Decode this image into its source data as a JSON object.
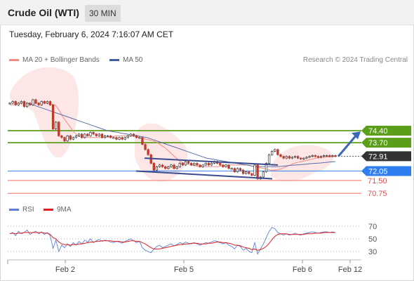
{
  "header": {
    "title": "Crude Oil (WTI)",
    "interval": "30 MIN"
  },
  "timestamp": "Tuesday, February 6, 2024 7:16:07 AM CET",
  "legend": {
    "items": [
      {
        "label": "MA 20 + Bollinger Bands",
        "color": "#f28b82"
      },
      {
        "label": "MA 50",
        "color": "#3f5f9f"
      }
    ],
    "credit": "Research © 2024 Trading Central"
  },
  "rsi_legend": {
    "items": [
      {
        "label": "RSI",
        "color": "#5b7fd6"
      },
      {
        "label": "9MA",
        "color": "#e02020"
      }
    ]
  },
  "colors": {
    "resistance": "#5a9e1a",
    "pivot": "#4f8ef0",
    "support": "#f28b82",
    "current": "#333333",
    "arrow": "#3a66b5",
    "channel": "#3b4a8f"
  },
  "chart_data": [
    {
      "type": "candlestick",
      "ylim": [
        70.2,
        74.9
      ],
      "x_ticks": [
        "Feb 2",
        "Feb 5",
        "Feb 6",
        "Feb 12"
      ],
      "levels": [
        {
          "value": 74.4,
          "label": "74.40",
          "kind": "resistance"
        },
        {
          "value": 73.7,
          "label": "73.70",
          "kind": "resistance"
        },
        {
          "value": 72.91,
          "label": "72.91",
          "kind": "current"
        },
        {
          "value": 72.05,
          "label": "72.05",
          "kind": "pivot"
        },
        {
          "value": 71.5,
          "label": "71.50",
          "kind": "support"
        },
        {
          "value": 70.75,
          "label": "70.75",
          "kind": "support"
        }
      ],
      "close": [
        76.0,
        76.1,
        75.9,
        76.0,
        76.1,
        75.8,
        76.0,
        75.9,
        76.2,
        76.0,
        75.9,
        76.1,
        76.0,
        76.1,
        75.9,
        74.5,
        74.9,
        74.1,
        74.0,
        73.8,
        74.1,
        73.9,
        74.0,
        74.1,
        74.2,
        74.0,
        74.2,
        74.1,
        74.3,
        74.2,
        74.1,
        74.2,
        74.0,
        74.1,
        74.1,
        74.0,
        74.0,
        73.9,
        74.0,
        73.9,
        74.0,
        74.1,
        74.2,
        74.1,
        74.0,
        74.0,
        73.6,
        73.3,
        73.0,
        72.5,
        72.1,
        72.3,
        72.4,
        72.3,
        72.2,
        72.3,
        72.4,
        72.2,
        72.3,
        72.5,
        72.4,
        72.6,
        72.5,
        72.4,
        72.5,
        72.4,
        72.3,
        72.4,
        72.5,
        72.4,
        72.5,
        72.6,
        72.5,
        72.4,
        72.3,
        72.4,
        72.2,
        72.2,
        72.0,
        72.2,
        72.1,
        71.9,
        72.0,
        71.9,
        71.8,
        72.4,
        71.6,
        71.7,
        72.0,
        72.5,
        73.0,
        73.2,
        73.3,
        73.0,
        72.9,
        72.8,
        72.9,
        72.8,
        72.85,
        72.9,
        72.8,
        72.75,
        72.8,
        72.85,
        72.9,
        72.95,
        72.9,
        72.85,
        72.9,
        72.95,
        72.95,
        72.9,
        72.95,
        72.91
      ],
      "ma20": [
        75.9,
        75.9,
        76.0,
        76.0,
        76.0,
        76.0,
        75.9,
        76.0,
        76.0,
        76.0,
        76.0,
        75.9,
        75.9,
        75.6,
        75.2,
        74.9,
        74.6,
        74.3,
        74.1,
        74.0,
        74.0,
        74.0,
        74.0,
        74.0,
        74.0,
        74.0,
        74.0,
        74.05,
        74.1,
        74.1,
        74.1,
        74.1,
        74.1,
        74.05,
        74.0,
        73.95,
        73.9,
        73.85,
        73.8,
        73.7,
        73.55,
        73.4,
        73.2,
        73.0,
        72.8,
        72.6,
        72.5,
        72.45,
        72.4,
        72.35,
        72.3,
        72.3,
        72.3,
        72.3,
        72.3,
        72.3,
        72.35,
        72.35,
        72.4,
        72.4,
        72.4,
        72.4,
        72.4,
        72.4,
        72.35,
        72.3,
        72.25,
        72.2,
        72.15,
        72.1,
        72.1,
        72.15,
        72.2,
        72.3,
        72.4,
        72.5,
        72.55,
        72.6,
        72.65,
        72.7,
        72.75,
        72.8,
        72.82,
        72.85,
        72.87,
        72.88,
        72.9
      ],
      "ma50": [
        76.0,
        75.9,
        75.8,
        75.7,
        75.6,
        75.5,
        75.4,
        75.3,
        75.2,
        75.1,
        75.0,
        74.9,
        74.8,
        74.7,
        74.6,
        74.5,
        74.4,
        74.35,
        74.3,
        74.25,
        74.2,
        74.15,
        74.1,
        74.05,
        74.0,
        73.9,
        73.8,
        73.7,
        73.6,
        73.5,
        73.4,
        73.3,
        73.2,
        73.1,
        73.0,
        72.9,
        72.8,
        72.75,
        72.7,
        72.65,
        72.6,
        72.55,
        72.5,
        72.45,
        72.4,
        72.35,
        72.3,
        72.3,
        72.3,
        72.3,
        72.3,
        72.32,
        72.35,
        72.38,
        72.4,
        72.42,
        72.45,
        72.48,
        72.5,
        72.52,
        72.55,
        72.58,
        72.6
      ],
      "channel": {
        "start": [
          72.8,
          72.05
        ],
        "end": [
          72.4,
          71.6
        ]
      },
      "arrow": {
        "from": 72.9,
        "to": 74.35
      }
    },
    {
      "type": "line",
      "series": [
        {
          "name": "RSI"
        },
        {
          "name": "9MA"
        }
      ],
      "y_ticks": [
        70,
        50,
        30
      ],
      "ylim": [
        15,
        85
      ],
      "rsi": [
        58,
        60,
        55,
        62,
        58,
        60,
        64,
        57,
        60,
        62,
        58,
        61,
        57,
        60,
        55,
        35,
        48,
        30,
        40,
        36,
        42,
        38,
        44,
        40,
        46,
        42,
        48,
        45,
        50,
        44,
        47,
        49,
        46,
        48,
        47,
        45,
        44,
        46,
        45,
        43,
        46,
        48,
        50,
        47,
        44,
        46,
        36,
        32,
        30,
        28,
        34,
        38,
        40,
        36,
        38,
        40,
        42,
        39,
        41,
        44,
        42,
        45,
        43,
        42,
        44,
        42,
        40,
        42,
        44,
        43,
        45,
        47,
        46,
        44,
        42,
        44,
        40,
        38,
        34,
        40,
        38,
        32,
        35,
        30,
        28,
        44,
        26,
        34,
        42,
        52,
        62,
        68,
        66,
        60,
        58,
        56,
        58,
        56,
        57,
        59,
        57,
        56,
        58,
        59,
        60,
        61,
        60,
        59,
        60,
        61,
        61,
        60,
        61,
        60
      ],
      "ma9": [
        58,
        59,
        58,
        59,
        59,
        60,
        60,
        60,
        60,
        60,
        60,
        60,
        59,
        59,
        57,
        52,
        50,
        45,
        42,
        41,
        41,
        40,
        41,
        41,
        42,
        42,
        43,
        44,
        45,
        45,
        46,
        46,
        47,
        47,
        47,
        47,
        46,
        46,
        46,
        45,
        45,
        46,
        47,
        47,
        46,
        46,
        44,
        42,
        39,
        36,
        34,
        34,
        34,
        35,
        36,
        37,
        38,
        39,
        40,
        41,
        41,
        42,
        42,
        43,
        43,
        43,
        42,
        42,
        42,
        43,
        43,
        44,
        45,
        45,
        44,
        44,
        43,
        42,
        40,
        40,
        39,
        37,
        36,
        35,
        33,
        34,
        32,
        33,
        35,
        38,
        43,
        49,
        54,
        57,
        58,
        58,
        58,
        57,
        57,
        57,
        57,
        57,
        57,
        58,
        58,
        58,
        59,
        59,
        59,
        60,
        60,
        60,
        60,
        60
      ]
    }
  ]
}
